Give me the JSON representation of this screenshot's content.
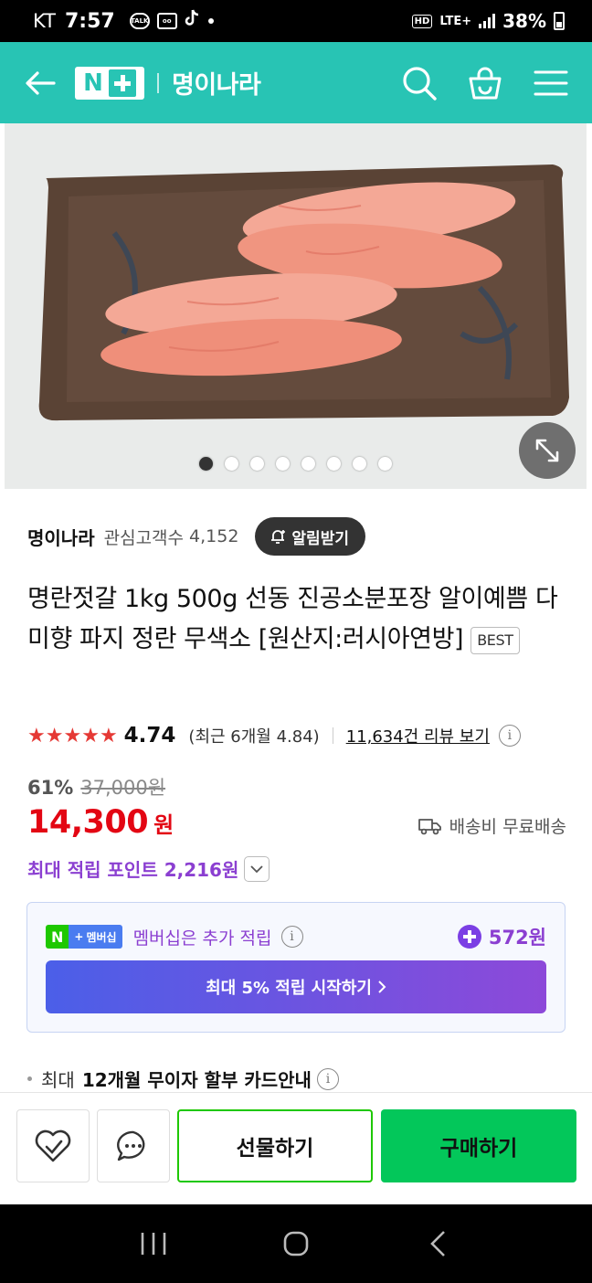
{
  "status_bar": {
    "carrier": "KT",
    "time": "7:57",
    "hd": "HD",
    "network": "LTE+",
    "battery": "38%"
  },
  "header": {
    "logo_text": "N",
    "store_title": "명이나라",
    "icons": [
      "back-arrow-icon",
      "search-icon",
      "shopping-bag-icon",
      "menu-icon"
    ]
  },
  "gallery": {
    "total_images": 8,
    "active_index": 0,
    "colors": {
      "background": "#e9ebea",
      "plate": "#5a4335",
      "roe": "#f0957e"
    }
  },
  "store": {
    "name": "명이나라",
    "fans_label": "관심고객수",
    "fans_count": "4,152",
    "alarm_label": "알림받기"
  },
  "product": {
    "title": "명란젓갈 1kg 500g 선동 진공소분포장 알이예쁨 다미향 파지 정란 무색소 [원산지:러시아연방]",
    "badge": "BEST"
  },
  "rating": {
    "stars": 4.74,
    "value": "4.74",
    "recent": "(최근 6개월 4.84)",
    "review_link": "11,634건 리뷰 보기"
  },
  "price": {
    "discount_rate": "61%",
    "original": "37,000원",
    "sale": "14,300",
    "currency": "원",
    "shipping": "배송비 무료배송",
    "max_points": "최대 적립 포인트 2,216원"
  },
  "membership": {
    "badge_n": "N",
    "badge_label": "멤버십",
    "text": "멤버십은 추가 적립",
    "amount": "572원",
    "cta": "최대 5% 적립 시작하기"
  },
  "installment": {
    "prefix": "최대",
    "text": "12개월 무이자 할부 카드안내"
  },
  "actions": {
    "gift": "선물하기",
    "buy": "구매하기"
  },
  "colors": {
    "brand_teal": "#28c4b4",
    "sale_red": "#e30613",
    "points_purple": "#8b3fd1",
    "buy_green": "#03c75a"
  }
}
